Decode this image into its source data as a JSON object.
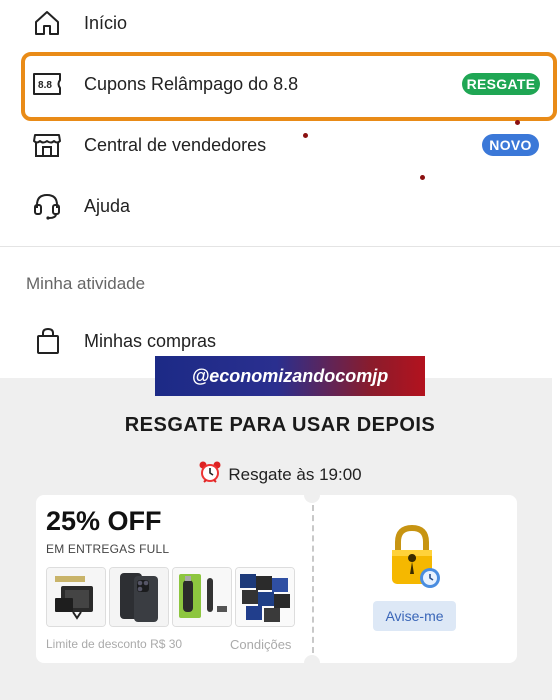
{
  "menu": {
    "inicio": "Início",
    "cupons": "Cupons Relâmpago do 8.8",
    "cupons_icon_text": "8.8",
    "cupons_badge": "RESGATE",
    "central": "Central de vendedores",
    "central_badge": "NOVO",
    "ajuda": "Ajuda"
  },
  "activity": {
    "section_title": "Minha atividade",
    "compras": "Minhas compras"
  },
  "watermark": "@economizandocomjp",
  "promo": {
    "title": "RESGATE PARA USAR DEPOIS",
    "time_text": "Resgate às 19:00",
    "coupon": {
      "discount": "25% OFF",
      "subtitle": "EM ENTREGAS FULL",
      "limit": "Limite de desconto R$ 30",
      "conditions": "Condições",
      "button": "Avise-me"
    }
  },
  "colors": {
    "highlight": "#e98b17",
    "resgate_badge": "#1fa654",
    "novo_badge": "#3b78d8",
    "avise_bg": "#dde8f6",
    "avise_text": "#3a66b8"
  },
  "icons": [
    "home-icon",
    "coupon-icon",
    "store-icon",
    "headset-icon",
    "bag-icon",
    "alarm-clock-icon",
    "lock-icon"
  ]
}
